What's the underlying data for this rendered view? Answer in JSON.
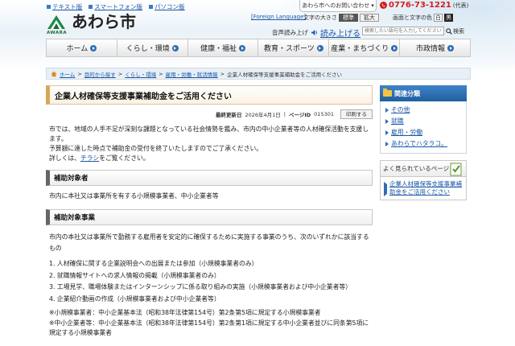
{
  "header": {
    "top_links": [
      "テキスト版",
      "スマートフォン版",
      "パソコン版"
    ],
    "logo_text": "あわら市",
    "logo_sub": "AWARA",
    "contact_label": "あわら市へのお問い合わせ",
    "phone_number": "0776-73-1221",
    "phone_note": "(代表)",
    "foreign_language": "[Foreign Language]",
    "font_size_label": "文字の大きさ",
    "font_size_standard": "標準",
    "font_size_large": "拡大",
    "color_label": "画面と文字の色",
    "color_white": "白",
    "color_black": "黒",
    "voice_label": "音声読み上げ",
    "voice_link": "読み上げる",
    "search_placeholder": "検索したい語句を入力してください",
    "search_button": "検索"
  },
  "nav": {
    "items": [
      "ホーム",
      "くらし・環境",
      "健康・福祉",
      "教育・スポーツ",
      "産業・まちづくり",
      "市政情報"
    ]
  },
  "breadcrumb": {
    "items": [
      "ホーム",
      "目的から探す",
      "くらし・環境",
      "雇用・労働・就活情報"
    ],
    "current": "企業人材確保等支援事業補助金をご活用ください",
    "sep": ">"
  },
  "main": {
    "title": "企業人材確保等支援事業補助金をご活用ください",
    "updated_label": "最終更新日",
    "updated_date": "2026年4月1日",
    "page_id_label": "ページID",
    "page_id": "015301",
    "print_button": "印刷する",
    "intro_1": "市では、地域の人手不足が深刻な課題となっている社会情勢を鑑み、市内の中小企業者等の人材確保活動を支援します。",
    "intro_2": "予算額に達した時点で補助金の受付を終了いたしますのでご了承ください。",
    "intro_3_pre": "詳しくは、",
    "intro_3_link": "チラシ",
    "intro_3_post": "をご覧ください。",
    "section_1_title": "補助対象者",
    "section_1_text": "市内に本社又は事業所を有する小規模事業者、中小企業者等",
    "section_2_title": "補助対象事業",
    "section_2_text": "市内の本社又は事業所で勤務する雇用者を安定的に確保するために実施する事業のうち、次のいずれかに該当するもの",
    "list": [
      "1. 人材確保に関する企業説明会への出展または参加（小規模事業者のみ）",
      "2. 就職情報サイトへの求人情報の掲載（小規模事業者のみ）",
      "3. 工場見学、職場体験またはインターンシップに係る取り組みの実施（小規模事業者および中小企業者等）",
      "4. 企業紹介動画の作成（小規模事業者および中小企業者等）"
    ],
    "note_1": "※小規模事業者：中小企業基本法（昭和38年法律第154号）第2条第5項に規定する小規模事業者",
    "note_2": "※中小企業者等：中小企業基本法（昭和38年法律第154号）第2条第1項に規定する中小企業者並びに同条第5項に規定する小規模事業者"
  },
  "sidebar": {
    "related_title": "関連分類",
    "related": [
      "その他",
      "就職",
      "雇用・労働",
      "あわらでハタラコ。"
    ],
    "often_title": "よく見られているページ",
    "often": [
      "企業人材確保等支援事業補助金をご活用ください"
    ]
  },
  "colors": {
    "accent_blue": "#1f5f9f",
    "link": "#1a57a6",
    "phone_red": "#d81c1c",
    "title_bar": "#d9a65a"
  }
}
